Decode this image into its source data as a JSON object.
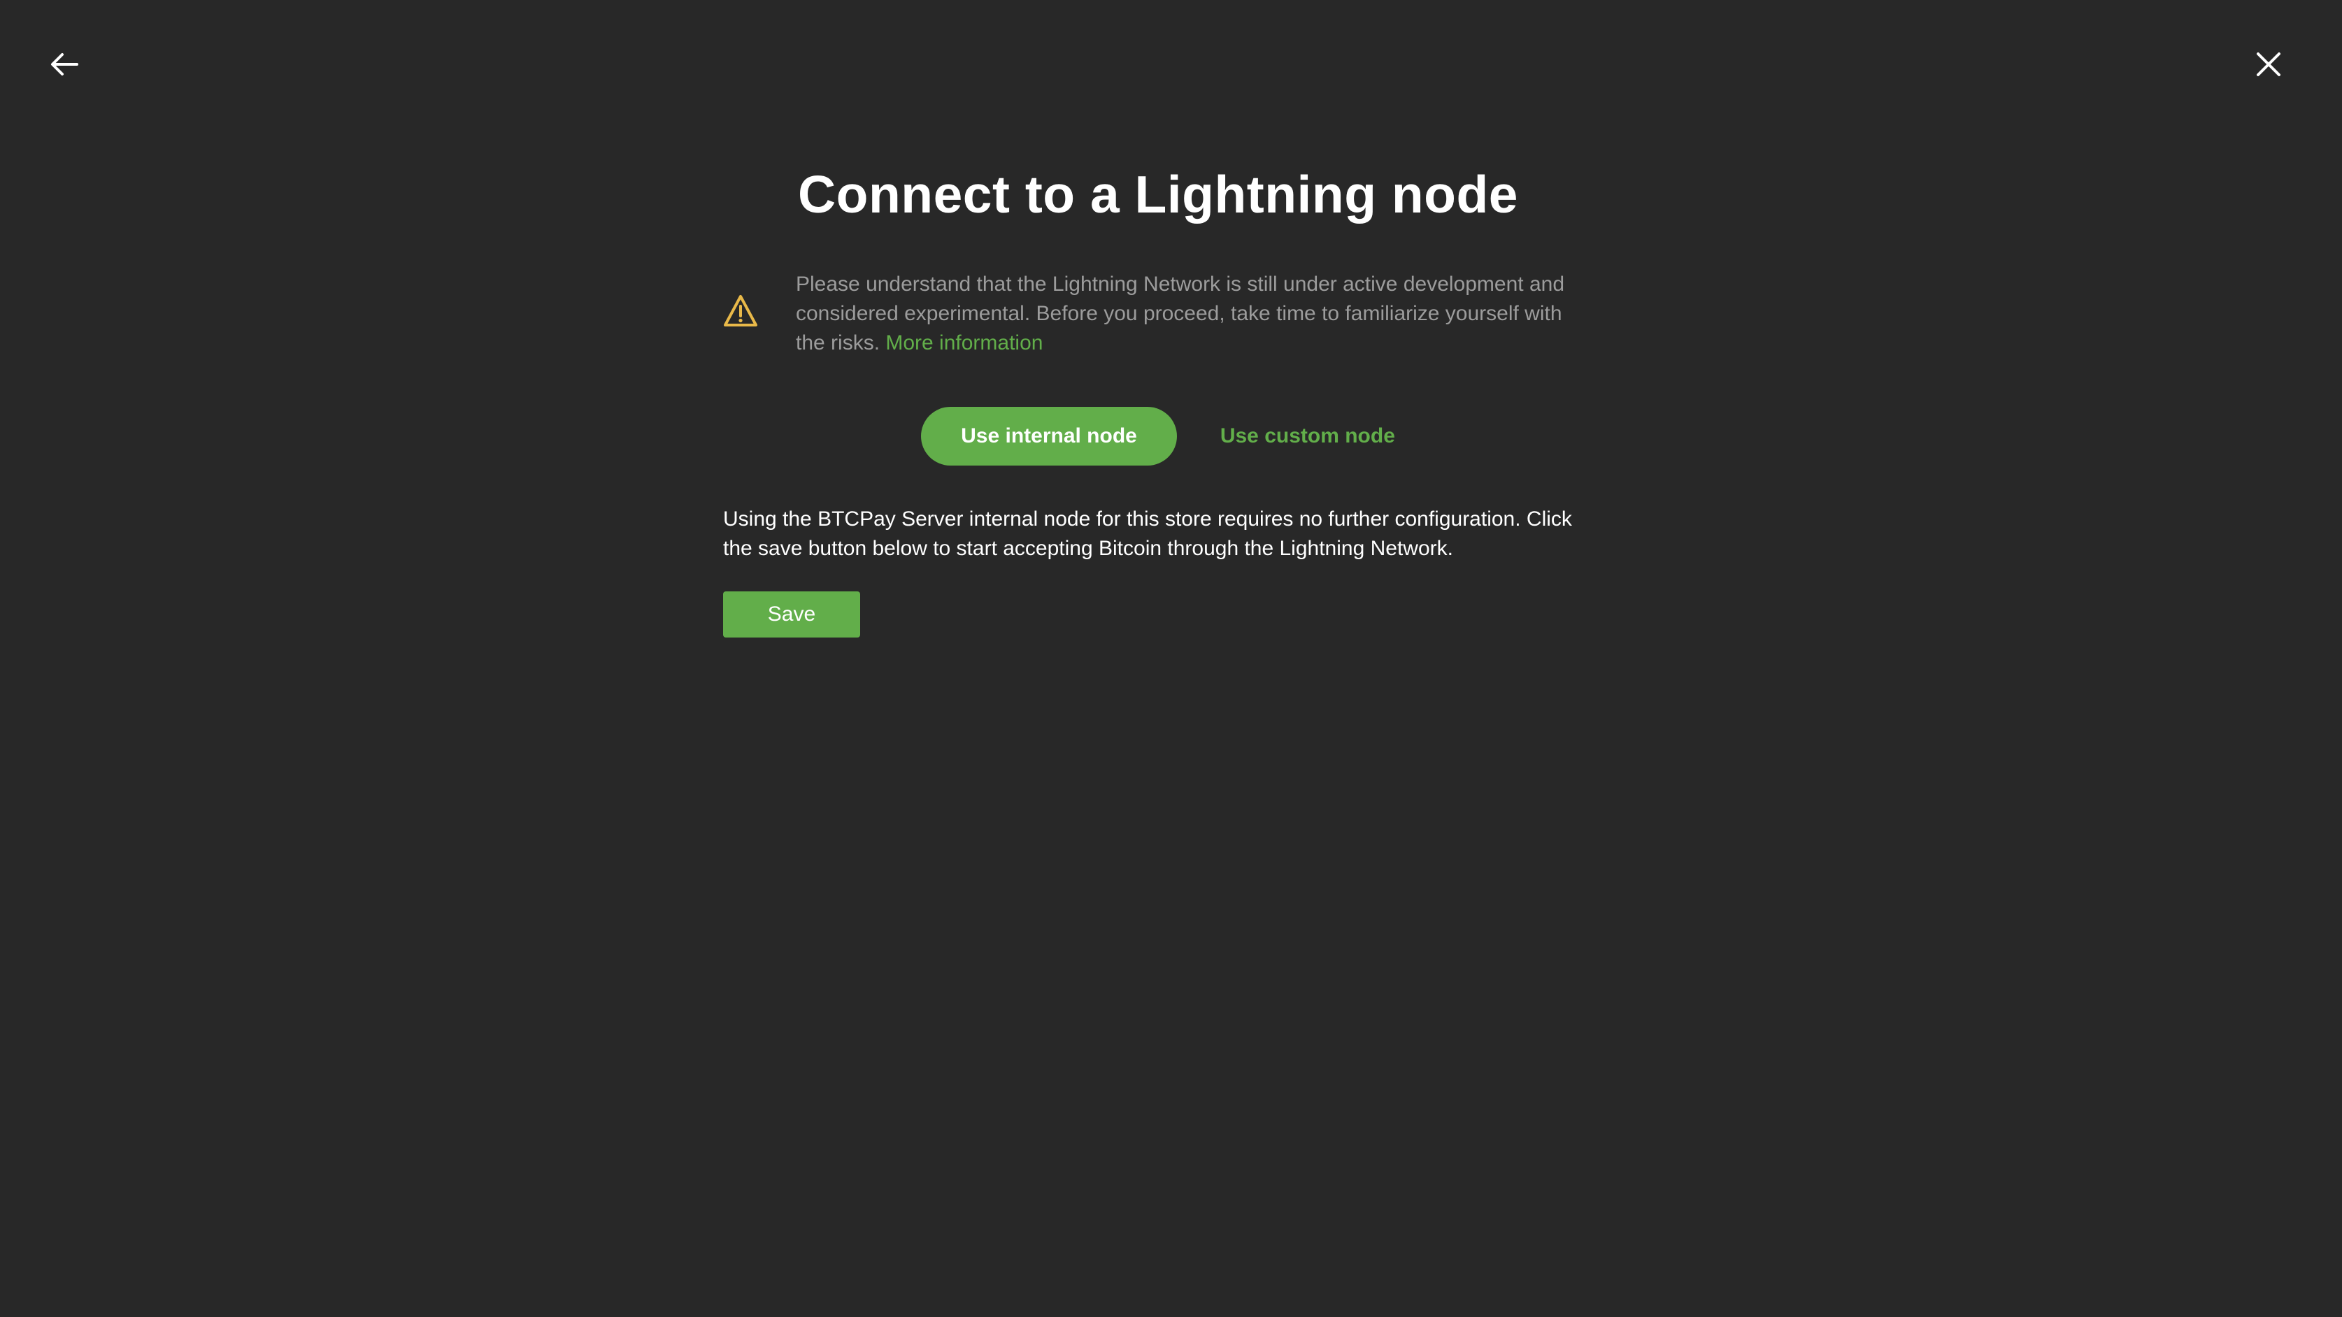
{
  "title": "Connect to a Lightning node",
  "warning": {
    "text": "Please understand that the Lightning Network is still under active development and considered experimental. Before you proceed, take time to familiarize yourself with the risks.",
    "link_label": "More information",
    "icon": "warning-triangle-icon",
    "icon_color": "#e9b949"
  },
  "tabs": [
    {
      "label": "Use internal node",
      "active": true
    },
    {
      "label": "Use custom node",
      "active": false
    }
  ],
  "description": "Using the BTCPay Server internal node for this store requires no further configuration. Click the save button below to start accepting Bitcoin through the Lightning Network.",
  "save_label": "Save",
  "colors": {
    "background": "#282828",
    "accent": "#62ae4a",
    "muted_text": "#9c9c9c",
    "warning": "#e9b949"
  },
  "icons": {
    "back": "arrow-left-icon",
    "close": "close-icon"
  }
}
